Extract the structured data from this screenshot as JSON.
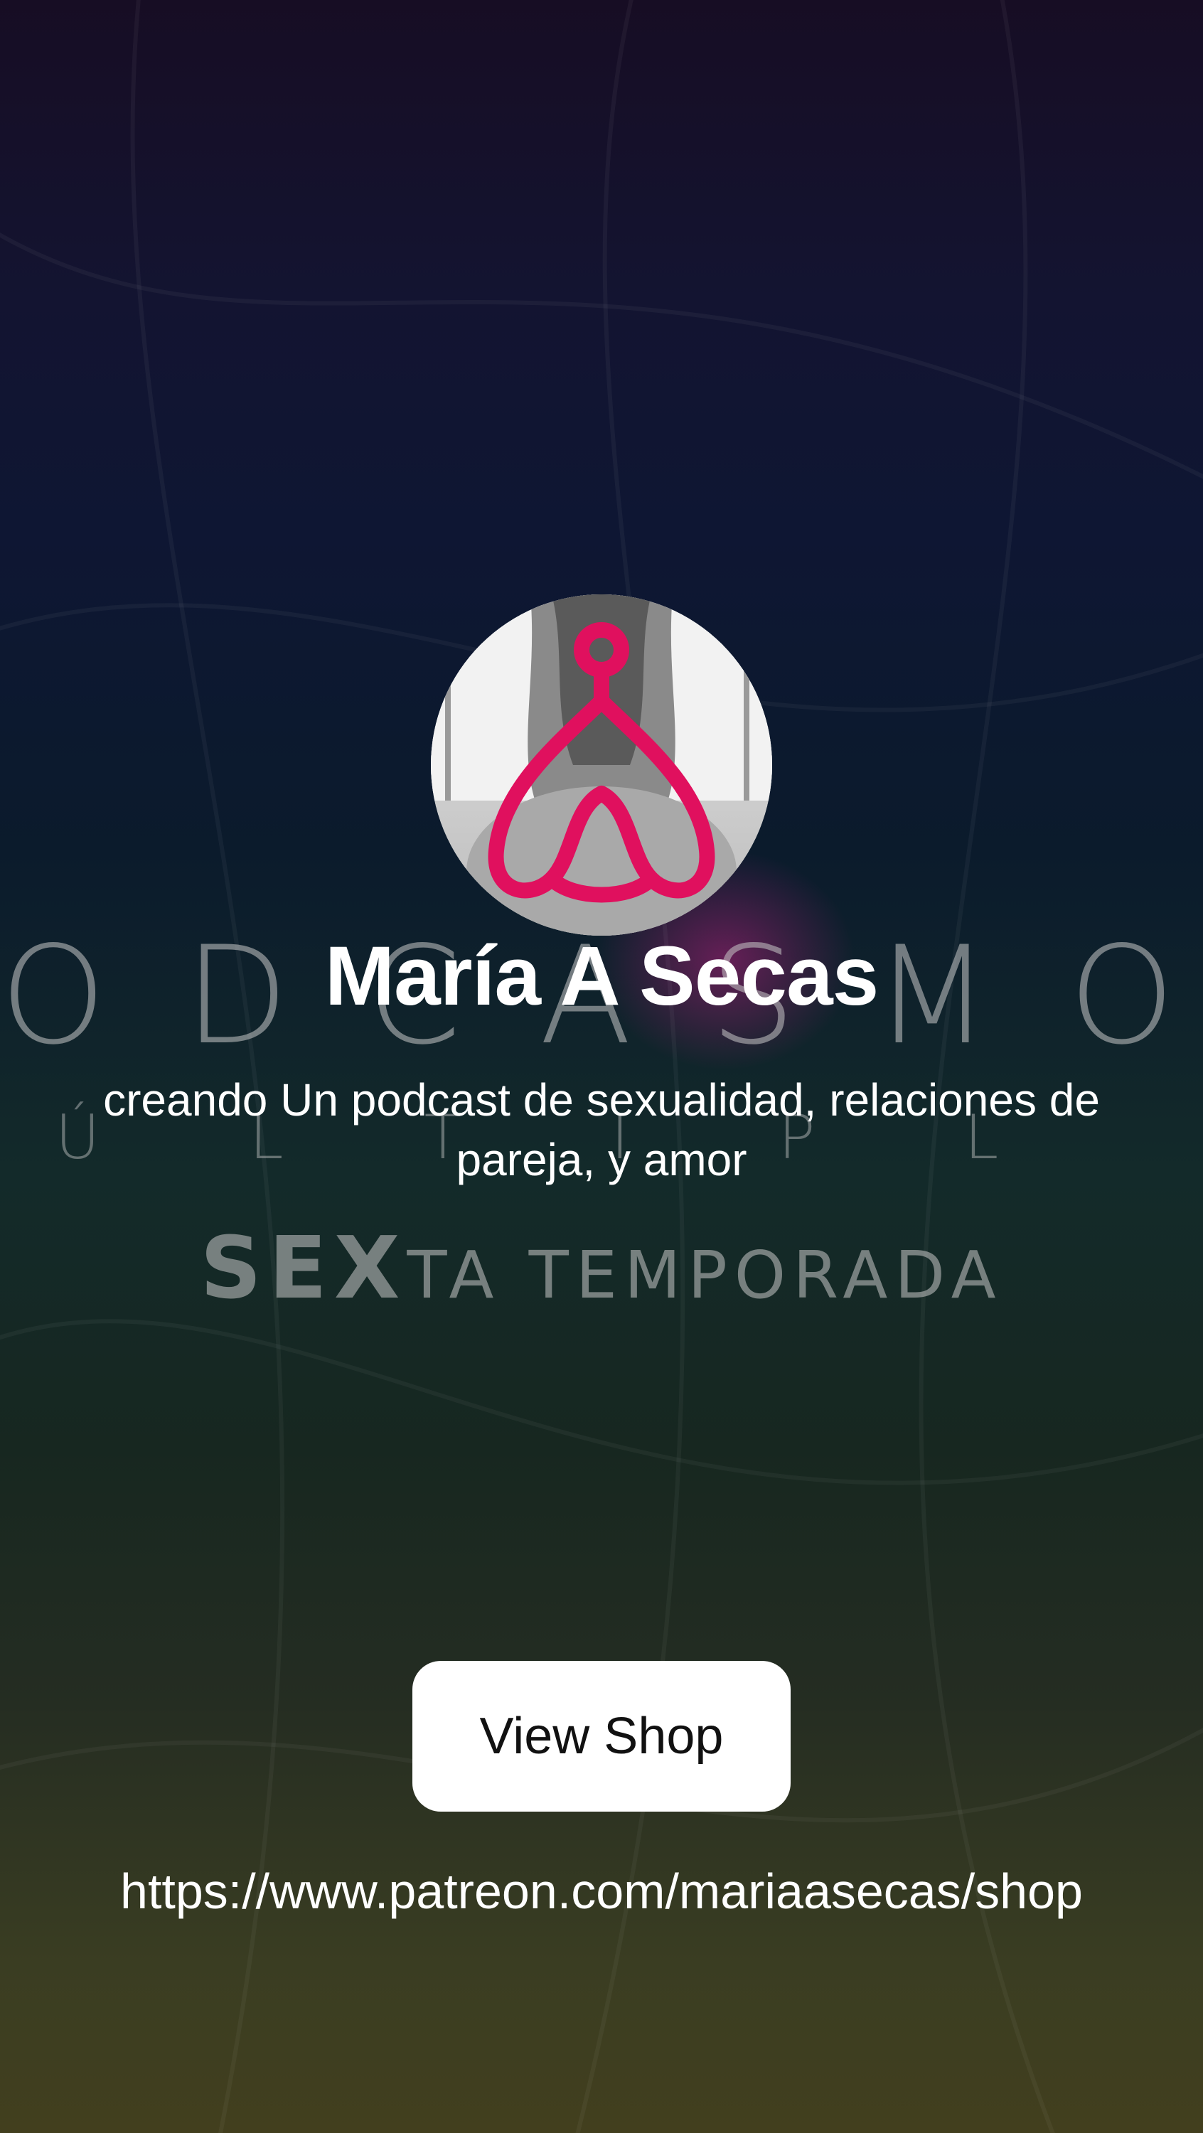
{
  "background": {
    "poster_line1": "ODCASMO",
    "poster_line2": "ÚLTIPL",
    "poster_line3_emphasis": "SEX",
    "poster_line3_rest": "TA TEMPORADA",
    "colors": {
      "top": "#170d24",
      "middle": "#0b1b2c",
      "bottom": "#423f1e",
      "glow": "#d21e8c"
    }
  },
  "profile": {
    "avatar_icon": "heart-logo-icon",
    "logo_color": "#e0105e",
    "name": "María A Secas",
    "tagline": "creando Un podcast de sexualidad, relaciones de pareja, y amor"
  },
  "actions": {
    "view_shop_label": "View Shop",
    "shop_url": "https://www.patreon.com/mariaasecas/shop"
  }
}
